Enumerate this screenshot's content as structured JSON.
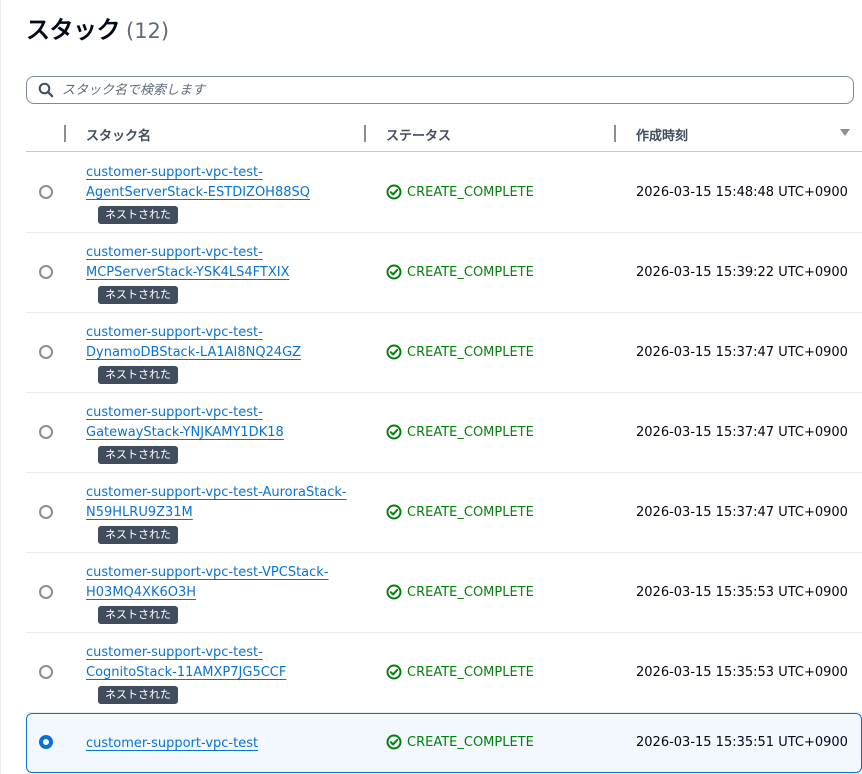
{
  "header": {
    "title": "スタック",
    "count": "(12)"
  },
  "search": {
    "placeholder": "スタック名で検索します",
    "value": "",
    "icon": "search-icon"
  },
  "table": {
    "columns": {
      "name": "スタック名",
      "status": "ステータス",
      "created": "作成時刻"
    },
    "sort_icon": "caret-down-icon",
    "rows": [
      {
        "name_lines": [
          "customer-support-vpc-test-",
          "AgentServerStack-ESTDIZOH88SQ"
        ],
        "badge": "ネストされた",
        "status": "CREATE_COMPLETE",
        "created": "2026-03-15 15:48:48 UTC+0900",
        "selected": false
      },
      {
        "name_lines": [
          "customer-support-vpc-test-",
          "MCPServerStack-YSK4LS4FTXIX"
        ],
        "badge": "ネストされた",
        "status": "CREATE_COMPLETE",
        "created": "2026-03-15 15:39:22 UTC+0900",
        "selected": false
      },
      {
        "name_lines": [
          "customer-support-vpc-test-",
          "DynamoDBStack-LA1AI8NQ24GZ"
        ],
        "badge": "ネストされた",
        "status": "CREATE_COMPLETE",
        "created": "2026-03-15 15:37:47 UTC+0900",
        "selected": false
      },
      {
        "name_lines": [
          "customer-support-vpc-test-",
          "GatewayStack-YNJKAMY1DK18"
        ],
        "badge": "ネストされた",
        "status": "CREATE_COMPLETE",
        "created": "2026-03-15 15:37:47 UTC+0900",
        "selected": false
      },
      {
        "name_lines": [
          "customer-support-vpc-test-AuroraStack-",
          "N59HLRU9Z31M"
        ],
        "badge": "ネストされた",
        "status": "CREATE_COMPLETE",
        "created": "2026-03-15 15:37:47 UTC+0900",
        "selected": false
      },
      {
        "name_lines": [
          "customer-support-vpc-test-VPCStack-",
          "H03MQ4XK6O3H"
        ],
        "badge": "ネストされた",
        "status": "CREATE_COMPLETE",
        "created": "2026-03-15 15:35:53 UTC+0900",
        "selected": false
      },
      {
        "name_lines": [
          "customer-support-vpc-test-",
          "CognitoStack-11AMXP7JG5CCF"
        ],
        "badge": "ネストされた",
        "status": "CREATE_COMPLETE",
        "created": "2026-03-15 15:35:53 UTC+0900",
        "selected": false
      },
      {
        "name_lines": [
          "customer-support-vpc-test"
        ],
        "badge": "",
        "status": "CREATE_COMPLETE",
        "created": "2026-03-15 15:35:51 UTC+0900",
        "selected": true
      }
    ]
  },
  "colors": {
    "link": "#0972d3",
    "success": "#037f0c",
    "badge_bg": "#414d5c",
    "selected_bg": "#f2f8fd",
    "selected_border": "#0972d3"
  }
}
